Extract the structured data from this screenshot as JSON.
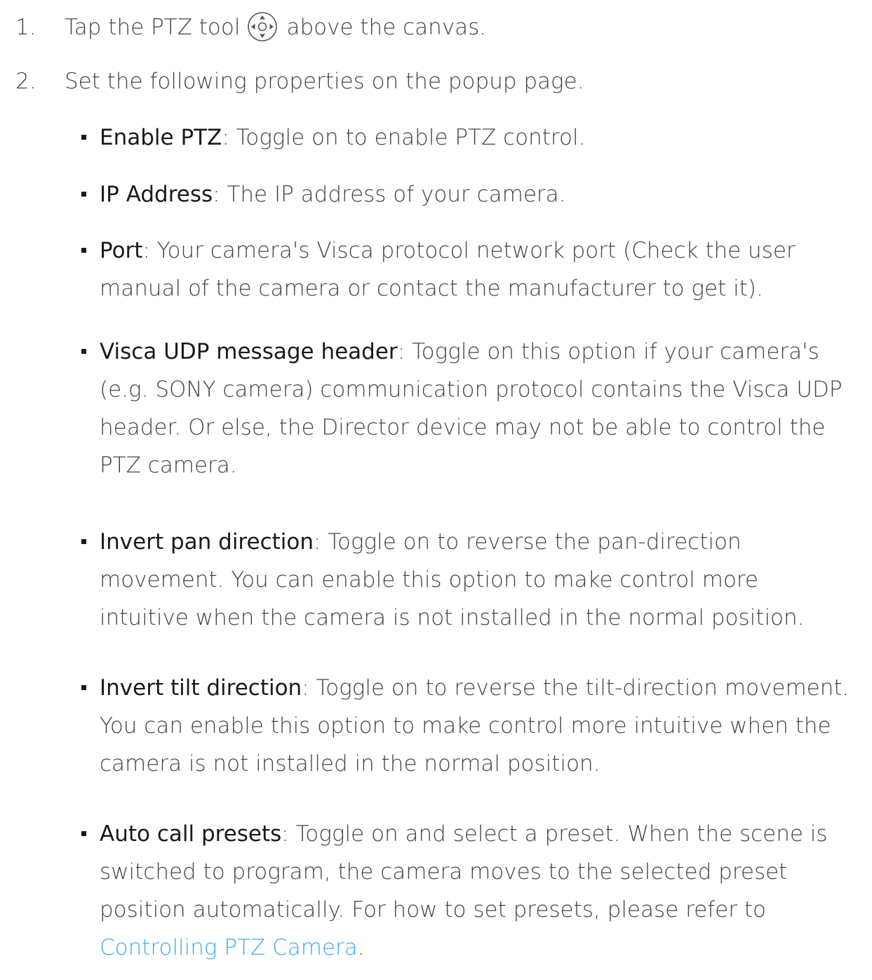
{
  "steps": [
    {
      "number": "1.",
      "text_before_icon": "Tap the PTZ tool",
      "icon": "ptz-control-icon",
      "text_after_icon": "above the canvas."
    },
    {
      "number": "2.",
      "text": "Set the following properties on the popup page."
    }
  ],
  "properties": [
    {
      "term": "Enable PTZ",
      "separator": ":",
      "description": " Toggle on to enable PTZ control."
    },
    {
      "term": "IP Address",
      "separator": ":",
      "description": " The IP address of your camera."
    },
    {
      "term": "Port",
      "separator": ":",
      "description": " Your camera's Visca protocol network port (Check the user manual of the camera or contact the manufacturer to get it)."
    },
    {
      "term": "Visca UDP message header",
      "separator": ":",
      "description": " Toggle on this option if your camera's (e.g. SONY camera) communication protocol contains the Visca UDP header. Or else, the Director device may not be able to control the PTZ camera."
    },
    {
      "term": "Invert pan direction",
      "separator": ":",
      "description": " Toggle on to reverse the pan-direction movement. You can enable this option to make control more intuitive when the camera is not installed in the normal position."
    },
    {
      "term": "Invert tilt direction",
      "separator": ":",
      "description": " Toggle on to reverse the tilt-direction movement. You can enable this option to make control more intuitive when the camera is not installed in the normal position."
    },
    {
      "term": "Auto call presets",
      "separator": ":",
      "description": " Toggle on and select a preset. When the scene is switched to program, the camera moves to the selected preset position automatically. For how to set presets, please refer to ",
      "link_text": "Controlling PTZ Camera",
      "trailing": "."
    }
  ],
  "colors": {
    "body_text": "#444444",
    "term_text": "#1a1a1a",
    "link": "#3fa9f5"
  }
}
